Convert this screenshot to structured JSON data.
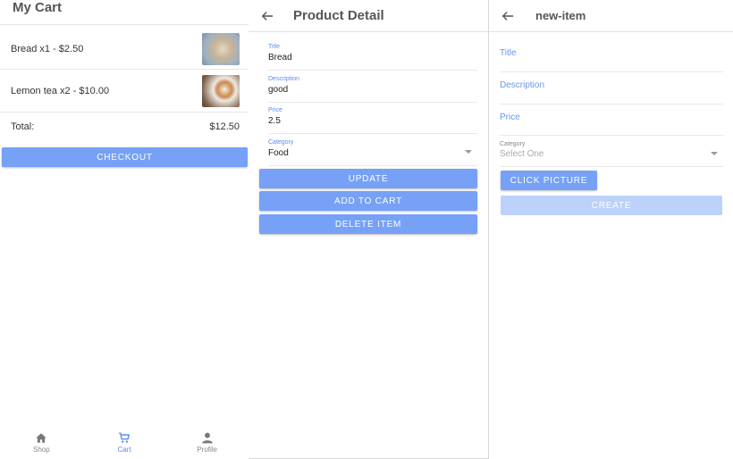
{
  "cart": {
    "title": "My Cart",
    "items": [
      {
        "label": "Bread x1 - $2.50",
        "image": "bread-photo"
      },
      {
        "label": "Lemon tea x2 - $10.00",
        "image": "tea-photo"
      }
    ],
    "total_label": "Total:",
    "total_value": "$12.50",
    "checkout_label": "CHECKOUT",
    "tabs": [
      {
        "label": "Shop",
        "icon": "home-icon"
      },
      {
        "label": "Cart",
        "icon": "cart-icon"
      },
      {
        "label": "Profile",
        "icon": "person-icon"
      }
    ],
    "active_tab_color": "#5b8def"
  },
  "detail": {
    "title": "Product Detail",
    "fields": [
      {
        "label": "Title",
        "value": "Bread"
      },
      {
        "label": "Description",
        "value": "good"
      },
      {
        "label": "Price",
        "value": "2.5"
      },
      {
        "label": "Category",
        "value": "Food"
      }
    ],
    "buttons": {
      "update": "UPDATE",
      "add_to_cart": "ADD TO CART",
      "delete": "DELETE ITEM"
    },
    "accent": "#76a1f7"
  },
  "new_item": {
    "title": "new-item",
    "title_placeholder": "Title",
    "description_placeholder": "Description",
    "price_placeholder": "Price",
    "category_label": "Category",
    "category_value": "Select One",
    "click_picture": "CLICK PICTURE",
    "create": "CREATE"
  }
}
